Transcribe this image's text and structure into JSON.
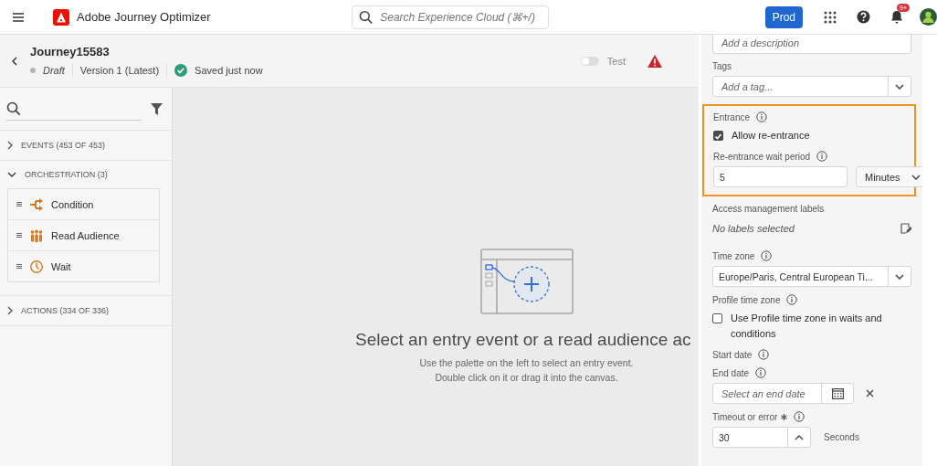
{
  "header": {
    "app_name": "Adobe Journey Optimizer",
    "search": {
      "placeholder": "Search Experience Cloud (⌘+/)"
    },
    "environment": "Prod",
    "notification_badge": "9+"
  },
  "journey": {
    "name": "Journey15583",
    "status": "Draft",
    "version": "Version 1 (Latest)",
    "save_status": "Saved just now",
    "test_mode": {
      "label": "Test",
      "on": false
    }
  },
  "palette": {
    "sections": [
      {
        "label": "EVENTS (453 OF 453)",
        "expanded": false
      },
      {
        "label": "ORCHESTRATION (3)",
        "expanded": true,
        "items": [
          {
            "label": "Condition",
            "kind": "condition"
          },
          {
            "label": "Read Audience",
            "kind": "audience"
          },
          {
            "label": "Wait",
            "kind": "wait"
          }
        ]
      },
      {
        "label": "ACTIONS (334 OF 336)",
        "expanded": false
      }
    ]
  },
  "canvas": {
    "headline": "Select an entry event or a read audience ac",
    "hint_lines": [
      "Use the palette on the left to select an entry event.",
      "Double click on it or drag it into the canvas."
    ]
  },
  "properties": {
    "fields": [
      {
        "kind": "textarea",
        "placeholder": "Add a description"
      },
      {
        "kind": "combo",
        "label": "Tags",
        "placeholder": "Add a tag..."
      },
      {
        "kind": "group",
        "highlighted": true,
        "fields": [
          {
            "kind": "heading",
            "label": "Entrance",
            "info": true
          },
          {
            "kind": "checkbox",
            "label": "Allow re-entrance",
            "checked": true
          },
          {
            "kind": "number-unit",
            "label": "Re-entrance wait period",
            "info": true,
            "value": "5",
            "unit": "Minutes"
          }
        ]
      },
      {
        "kind": "labels",
        "label": "Access management labels",
        "value": "No labels selected"
      },
      {
        "kind": "combo",
        "label": "Time zone",
        "info": true,
        "value": "Europe/Paris, Central European Ti..."
      },
      {
        "kind": "heading",
        "label": "Profile time zone",
        "info": true
      },
      {
        "kind": "checkbox",
        "label": "Use Profile time zone in waits and conditions",
        "checked": false
      },
      {
        "kind": "heading",
        "label": "Start date",
        "info": true
      },
      {
        "kind": "date",
        "label": "End date",
        "info": true,
        "placeholder": "Select an end date"
      },
      {
        "kind": "stepper",
        "label": "Timeout or error",
        "info": true,
        "required": true,
        "value": "30",
        "unit": "Seconds"
      }
    ]
  }
}
